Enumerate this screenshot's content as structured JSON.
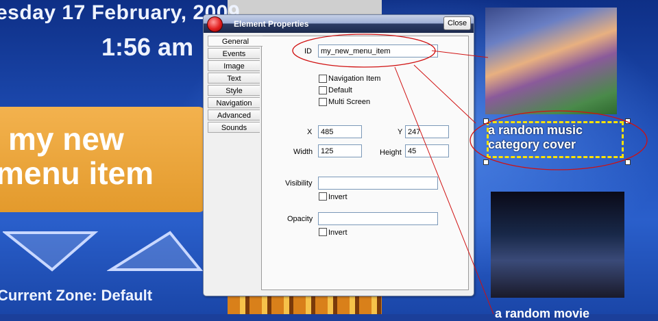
{
  "background": {
    "date": "esday 17 February, 2009",
    "time": "1:56 am",
    "menu_line1": "my new",
    "menu_line2": "menu item",
    "zone": "Current Zone: Default",
    "music_caption_line1": "a random music",
    "music_caption_line2": "category cover",
    "movie_caption": "a random movie"
  },
  "dialog": {
    "title": "Element Properties",
    "close_label": "Close",
    "tabs": [
      "General",
      "Events",
      "Image",
      "Text",
      "Style",
      "Navigation",
      "Advanced",
      "Sounds"
    ],
    "active_tab": "General",
    "fields": {
      "id_label": "ID",
      "id_value": "my_new_menu_item",
      "nav_item_label": "Navigation Item",
      "default_label": "Default",
      "multi_screen_label": "Multi Screen",
      "x_label": "X",
      "x_value": "485",
      "y_label": "Y",
      "y_value": "247",
      "width_label": "Width",
      "width_value": "125",
      "height_label": "Height",
      "height_value": "45",
      "visibility_label": "Visibility",
      "visibility_value": "",
      "visibility_invert_label": "Invert",
      "opacity_label": "Opacity",
      "opacity_value": "",
      "opacity_invert_label": "Invert"
    }
  },
  "colors": {
    "annotation": "#d01010",
    "selection": "#ffe300",
    "menu_tile": "#e8a032"
  }
}
